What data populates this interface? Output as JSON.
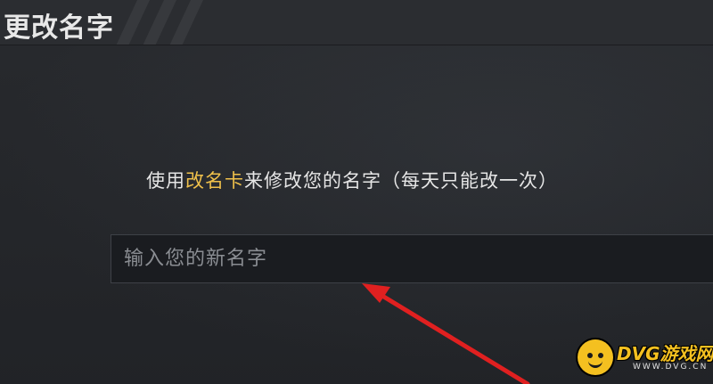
{
  "header": {
    "title": "更改名字"
  },
  "instruction": {
    "prefix": "使用",
    "highlight": "改名卡",
    "suffix": "来修改您的名字（每天只能改一次）"
  },
  "name_input": {
    "placeholder": "输入您的新名字",
    "value": ""
  },
  "annotation": {
    "color": "#e02020"
  },
  "watermark": {
    "name": "DVG游戏网",
    "url": "WWW.DVG.CN"
  },
  "colors": {
    "highlight": "#f0c14b",
    "watermark": "#f4c020"
  }
}
